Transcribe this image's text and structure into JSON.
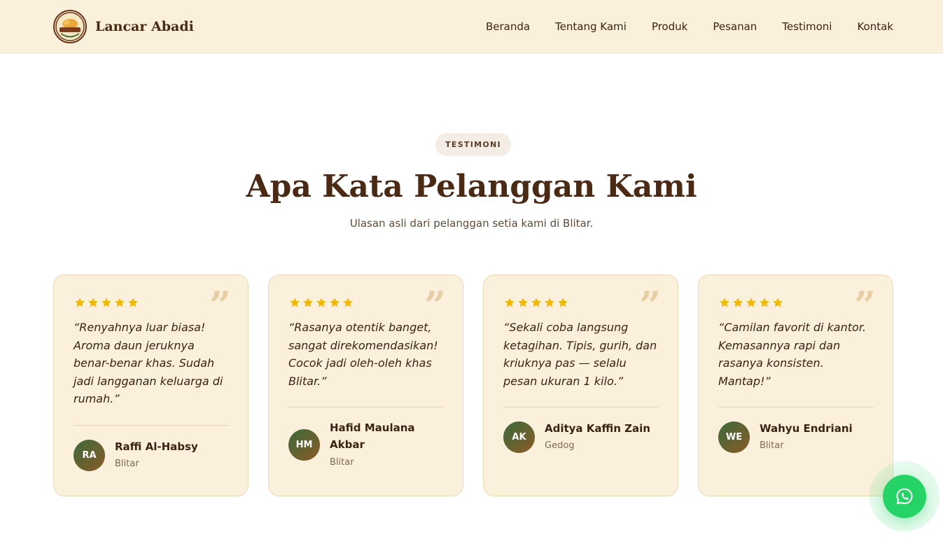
{
  "brand": {
    "name": "Lancar Abadi",
    "logo_icon": "lancar-abadi-logo"
  },
  "nav": {
    "items": [
      {
        "label": "Beranda"
      },
      {
        "label": "Tentang Kami"
      },
      {
        "label": "Produk"
      },
      {
        "label": "Pesanan"
      },
      {
        "label": "Testimoni"
      },
      {
        "label": "Kontak"
      }
    ]
  },
  "section": {
    "badge": "TESTIMONI",
    "title": "Apa Kata Pelanggan Kami",
    "subtitle": "Ulasan asli dari pelanggan setia kami di Blitar."
  },
  "testimonials": [
    {
      "rating": 5,
      "quote": "“Renyahnya luar biasa! Aroma daun jeruknya benar-benar khas. Sudah jadi langganan keluarga di rumah.”",
      "initials": "RA",
      "name": "Raffi Al-Habsy",
      "location": "Blitar"
    },
    {
      "rating": 5,
      "quote": "“Rasanya otentik banget, sangat direkomendasikan! Cocok jadi oleh-oleh khas Blitar.”",
      "initials": "HM",
      "name": "Hafid Maulana Akbar",
      "location": "Blitar"
    },
    {
      "rating": 5,
      "quote": "“Sekali coba langsung ketagihan. Tipis, gurih, dan kriuknya pas — selalu pesan ukuran 1 kilo.”",
      "initials": "AK",
      "name": "Aditya Kaffin Zain",
      "location": "Gedog"
    },
    {
      "rating": 5,
      "quote": "“Camilan favorit di kantor. Kemasannya rapi dan rasanya konsisten. Mantap!”",
      "initials": "WE",
      "name": "Wahyu Endriani",
      "location": "Blitar"
    }
  ],
  "quote_mark": "”",
  "whatsapp": {
    "icon": "whatsapp-icon",
    "color": "#25d366"
  },
  "colors": {
    "nav_bg": "#faf0dc",
    "card_bg": "#faf0dc",
    "heading": "#4a2a14",
    "star": "#f2b705"
  }
}
